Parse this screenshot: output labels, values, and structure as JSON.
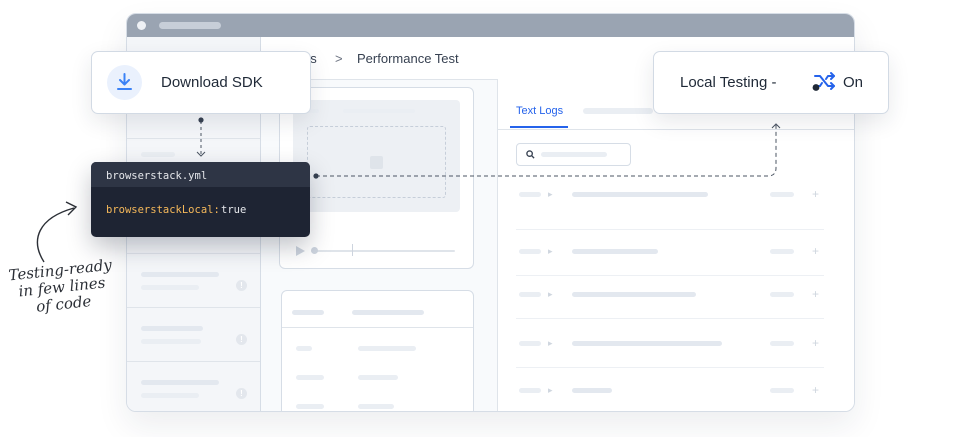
{
  "breadcrumb": {
    "parent_partial": "ds",
    "separator": ">",
    "current": "Performance Test"
  },
  "logs": {
    "active_tab": "Text Logs"
  },
  "sdk_card": {
    "label": "Download SDK",
    "icon": "download-icon"
  },
  "local_card": {
    "label": "Local Testing -",
    "toggle_state": "On",
    "icon": "shuffle-icon"
  },
  "code": {
    "filename": "browserstack.yml",
    "key": "browserstackLocal:",
    "value": "true"
  },
  "note": {
    "line1": "Testing-ready",
    "line2": "in few lines",
    "line3": "of code"
  },
  "colors": {
    "accent": "#2563eb",
    "code_key": "#f5b85a",
    "code_background": "#1e2433"
  }
}
